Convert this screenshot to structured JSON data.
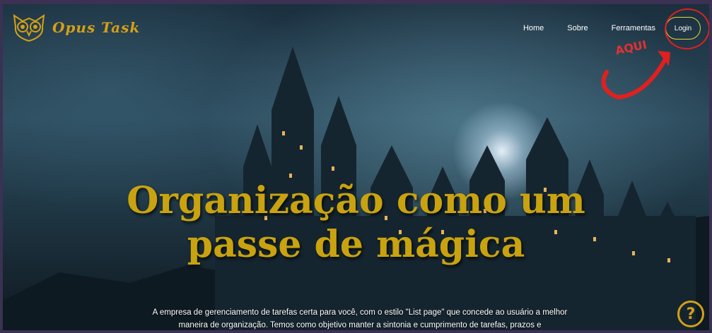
{
  "nav": {
    "logo_text": "Opus Task",
    "links": [
      "Home",
      "Sobre",
      "Ferramentas"
    ],
    "login_label": "Login",
    "annotation": "AQUI"
  },
  "hero": {
    "title_line1": "Organização como um",
    "title_line2": "passe de mágica",
    "description": "A empresa de gerenciamento de tarefas certa para você, com o estilo \"List page\" que concede ao usuário a melhor maneira de organização. Temos como objetivo manter a sintonia e cumprimento de tarefas, prazos e"
  },
  "help": {
    "symbol": "?"
  },
  "colors": {
    "gold": "#d4a017",
    "annotation_red": "#e02020",
    "login_border": "#e6d83a"
  },
  "icons": [
    "owl-logo-icon",
    "arrow-icon",
    "help-icon"
  ]
}
